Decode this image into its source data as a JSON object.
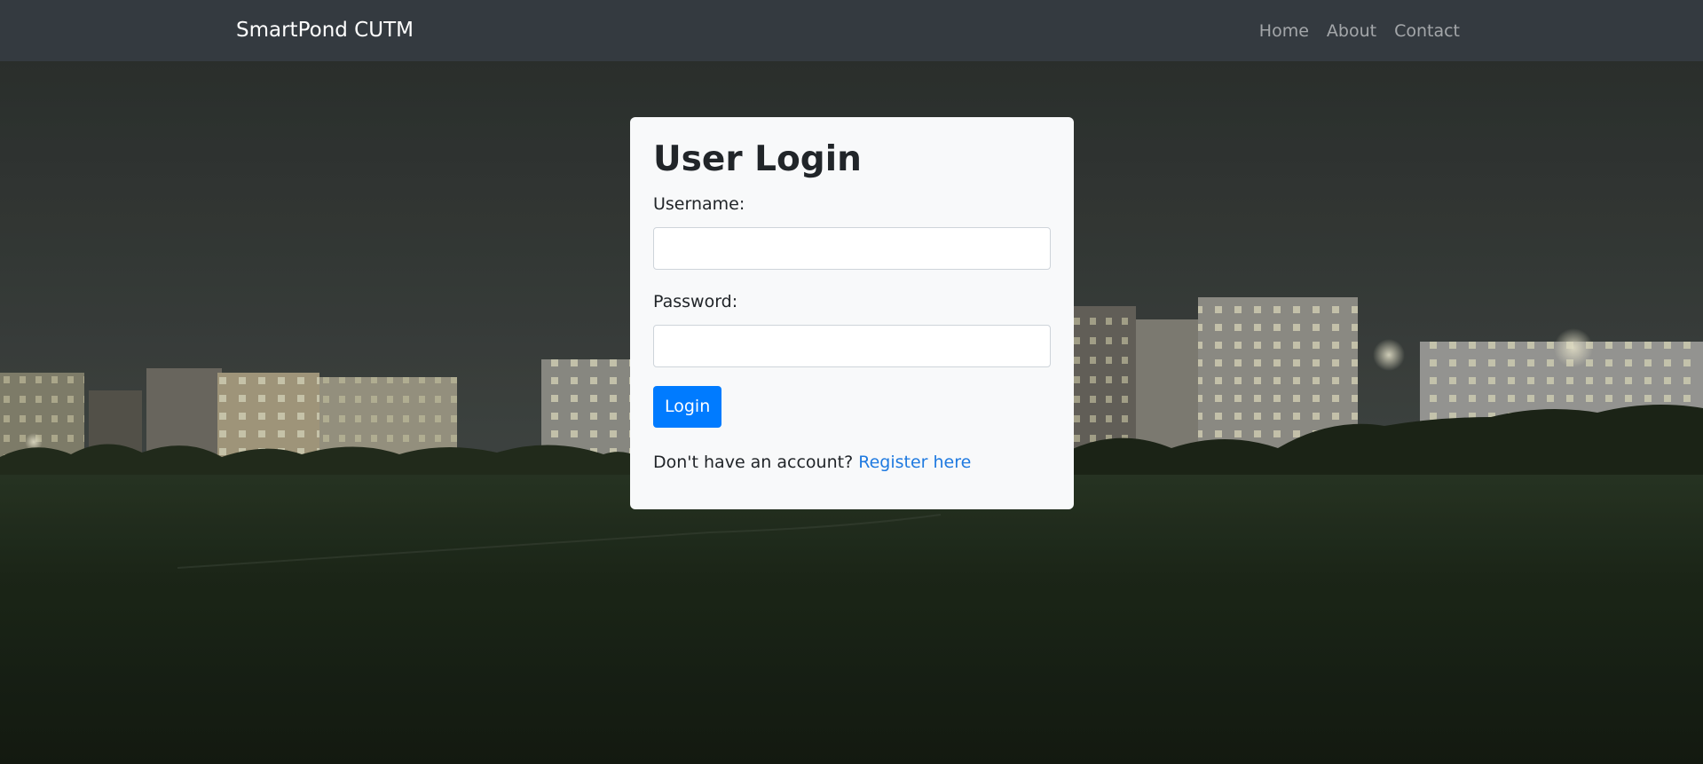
{
  "navbar": {
    "brand": "SmartPond CUTM",
    "links": [
      {
        "label": "Home"
      },
      {
        "label": "About"
      },
      {
        "label": "Contact"
      }
    ]
  },
  "login": {
    "title": "User Login",
    "username_label": "Username:",
    "username_value": "",
    "password_label": "Password:",
    "password_value": "",
    "submit_label": "Login",
    "register_prompt": "Don't have an account?",
    "register_link": "Register here"
  },
  "colors": {
    "navbar_bg": "#343a40",
    "card_bg": "#f8f9fa",
    "primary_button": "#007bff",
    "link": "#1f7ae0"
  },
  "background": {
    "icon": "campus-night-photo"
  }
}
